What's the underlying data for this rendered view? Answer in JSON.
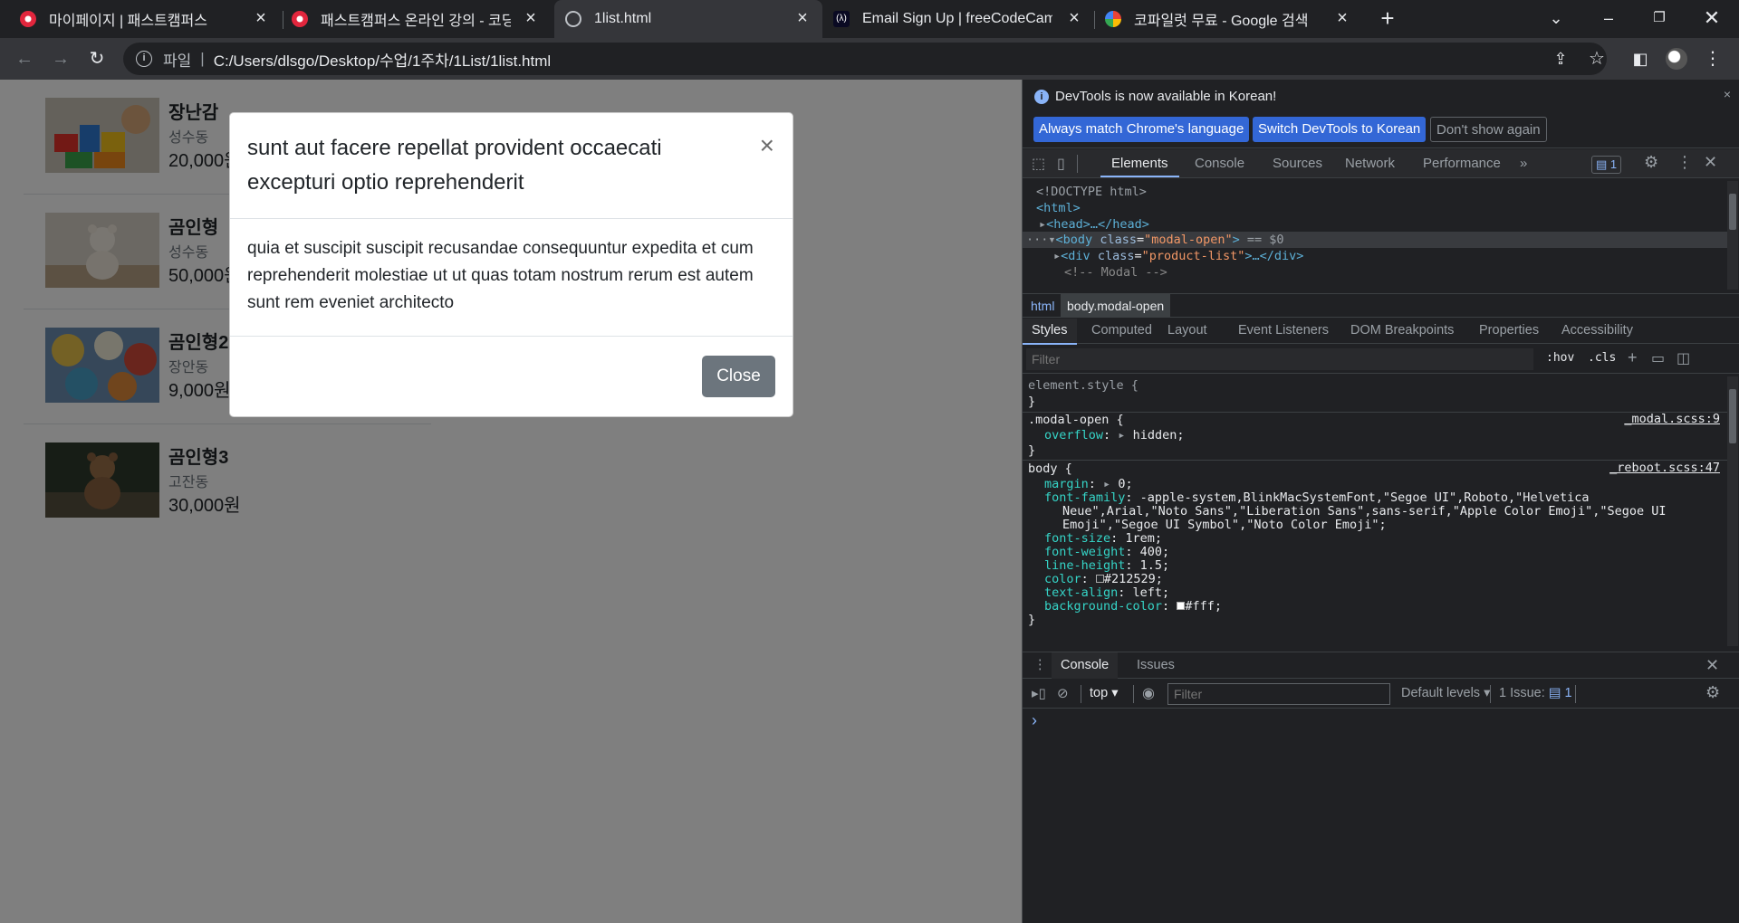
{
  "browser": {
    "tabs": [
      {
        "title": "마이페이지 | 패스트캠퍼스",
        "favicon": "fastcampus-icon",
        "active": false
      },
      {
        "title": "패스트캠퍼스 온라인 강의 - 코딩",
        "favicon": "fastcampus-icon",
        "active": false
      },
      {
        "title": "1list.html",
        "favicon": "globe-icon",
        "active": true
      },
      {
        "title": "Email Sign Up | freeCodeCamp.org",
        "favicon": "freecodecamp-icon",
        "active": false
      },
      {
        "title": "코파일럿 무료 - Google 검색",
        "favicon": "google-icon",
        "active": false
      }
    ],
    "new_tab": "+",
    "address": {
      "scheme": "파일",
      "url": "C:/Users/dlsgo/Desktop/수업/1주차/1List/1list.html"
    }
  },
  "products": [
    {
      "name": "장난감",
      "location": "성수동",
      "price": "20,000원"
    },
    {
      "name": "곰인형",
      "location": "성수동",
      "price": "50,000원"
    },
    {
      "name": "곰인형2",
      "location": "장안동",
      "price": "9,000원"
    },
    {
      "name": "곰인형3",
      "location": "고잔동",
      "price": "30,000원"
    }
  ],
  "modal": {
    "title": "sunt aut facere repellat provident occaecati excepturi optio reprehenderit",
    "close_x": "×",
    "body": "quia et suscipit suscipit recusandae consequuntur expedita et cum reprehenderit molestiae ut ut quas totam nostrum rerum est autem sunt rem eveniet architecto",
    "close_button": "Close"
  },
  "devtools": {
    "notice": "DevTools is now available in Korean!",
    "lang_buttons": [
      "Always match Chrome's language",
      "Switch DevTools to Korean",
      "Don't show again"
    ],
    "main_tabs": [
      "Elements",
      "Console",
      "Sources",
      "Network",
      "Performance"
    ],
    "issue_count": "1",
    "dom_lines": {
      "doctype": "<!DOCTYPE html>",
      "html_open": "<html>",
      "head": "<head>…</head>",
      "body_tag": "body",
      "body_class_attr": "class",
      "body_class_val": "\"modal-open\"",
      "body_suffix": "== $0",
      "div_tag": "div",
      "div_class_val": "\"product-list\"",
      "comment": "<!-- Modal -->"
    },
    "breadcrumb": [
      "html",
      "body.modal-open"
    ],
    "style_tabs": [
      "Styles",
      "Computed",
      "Layout",
      "Event Listeners",
      "DOM Breakpoints",
      "Properties",
      "Accessibility"
    ],
    "filter_placeholder": "Filter",
    "hov": ":hov",
    "cls": ".cls",
    "rules": {
      "element_style": "element.style {",
      "modal_open_selector": ".modal-open {",
      "modal_open_source": "_modal.scss:9",
      "overflow_prop": "overflow",
      "overflow_val": "hidden;",
      "body_selector": "body {",
      "body_source": "_reboot.scss:47",
      "margin_prop": "margin",
      "margin_val": "0;",
      "font_family_prop": "font-family",
      "font_family_val_1": "-apple-system,BlinkMacSystemFont,\"Segoe UI\",Roboto,\"Helvetica",
      "font_family_val_2": "Neue\",Arial,\"Noto Sans\",\"Liberation Sans\",sans-serif,\"Apple Color Emoji\",\"Segoe UI",
      "font_family_val_3": "Emoji\",\"Segoe UI Symbol\",\"Noto Color Emoji\";",
      "font_size": "1rem;",
      "font_weight": "400;",
      "line_height": "1.5;",
      "color": "#212529;",
      "text_align": "left;",
      "bg_color": "#fff;",
      "close_brace": "}"
    },
    "drawer_tabs": [
      "Console",
      "Issues"
    ],
    "console_context": "top",
    "console_filter": "Filter",
    "default_levels": "Default levels",
    "issues_label": "1 Issue:",
    "issues_count": "1",
    "prompt": "›"
  },
  "colors": {
    "accent": "#8ab4f8",
    "lang_btn": "#3367d6",
    "modal_btn": "#6c757d"
  }
}
